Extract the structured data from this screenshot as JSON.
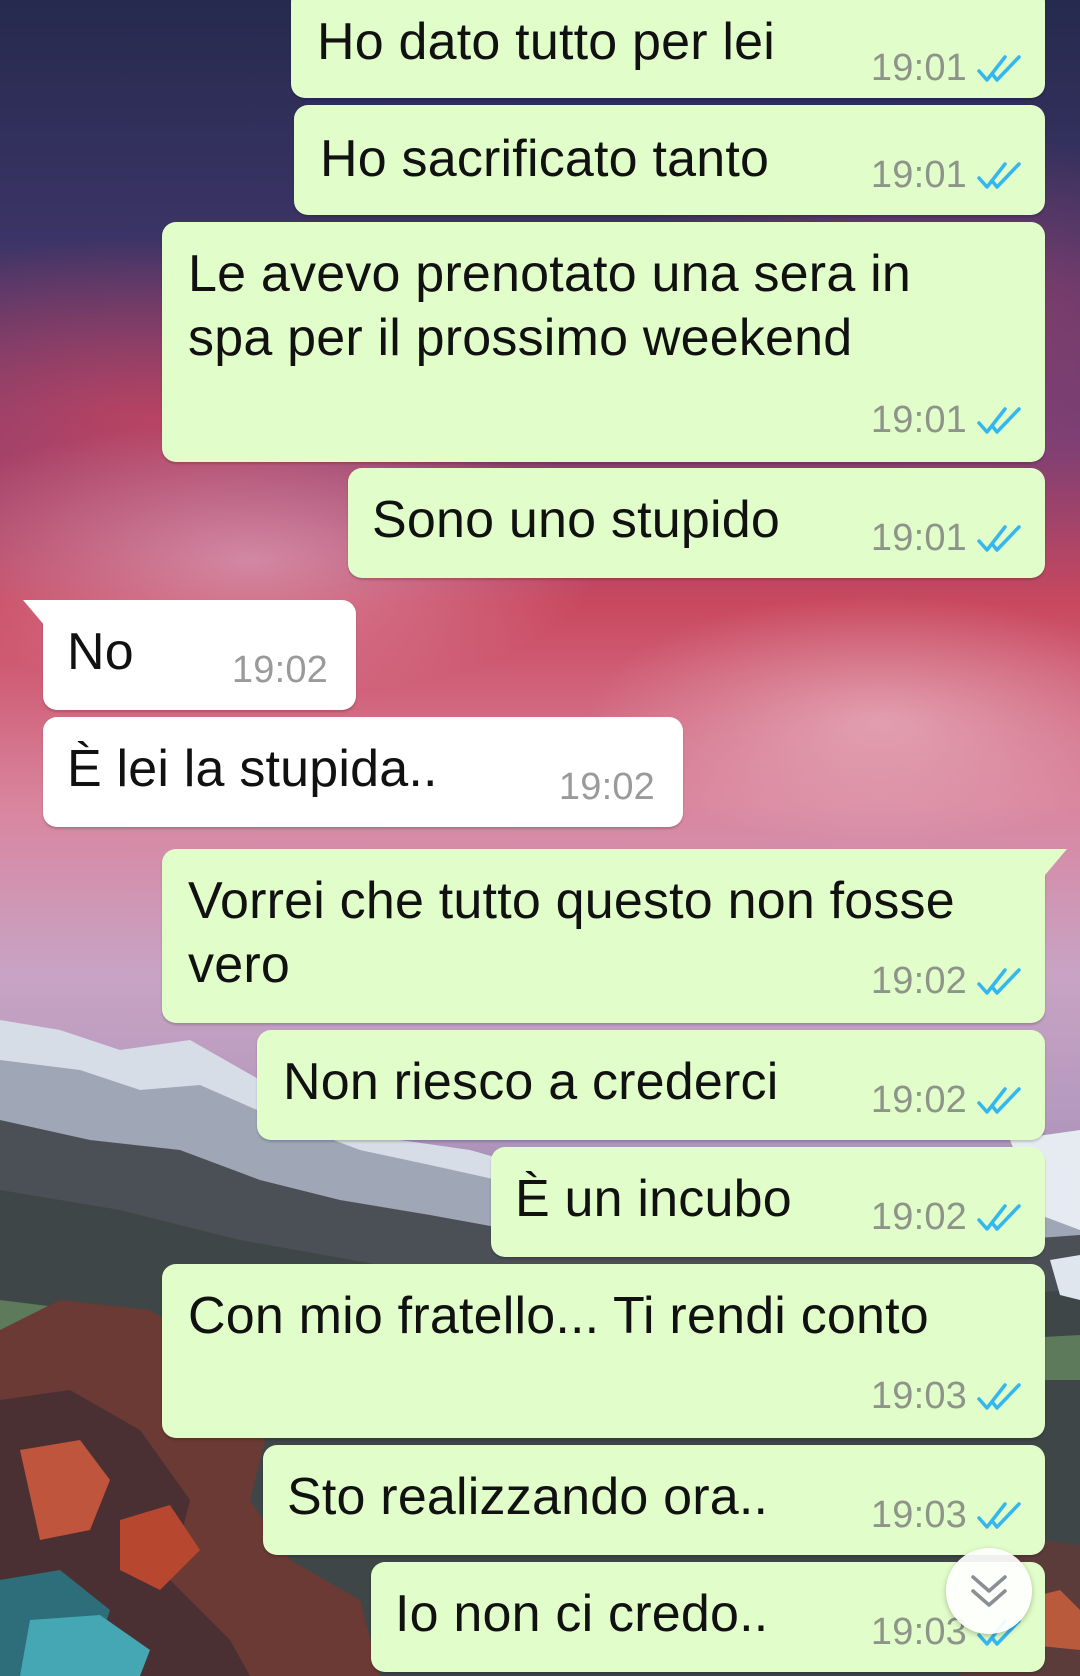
{
  "colors": {
    "outgoing_bubble": "#e1fdc9",
    "incoming_bubble": "#ffffff",
    "read_ticks": "#34b7f1",
    "timestamp": "#8e9489"
  },
  "messages": [
    {
      "id": "m1",
      "direction": "outgoing",
      "text": "Ho dato tutto per lei",
      "time": "19:01",
      "status": "read"
    },
    {
      "id": "m2",
      "direction": "outgoing",
      "text": "Ho sacrificato tanto",
      "time": "19:01",
      "status": "read"
    },
    {
      "id": "m3",
      "direction": "outgoing",
      "text": "Le avevo prenotato una sera in\nspa per il prossimo weekend",
      "time": "19:01",
      "status": "read"
    },
    {
      "id": "m4",
      "direction": "outgoing",
      "text": "Sono uno stupido",
      "time": "19:01",
      "status": "read"
    },
    {
      "id": "m5",
      "direction": "incoming",
      "text": "No",
      "time": "19:02"
    },
    {
      "id": "m6",
      "direction": "incoming",
      "text": "È lei la stupida..",
      "time": "19:02"
    },
    {
      "id": "m7",
      "direction": "outgoing",
      "text": "Vorrei che tutto questo non fosse\nvero",
      "time": "19:02",
      "status": "read"
    },
    {
      "id": "m8",
      "direction": "outgoing",
      "text": "Non riesco a crederci",
      "time": "19:02",
      "status": "read"
    },
    {
      "id": "m9",
      "direction": "outgoing",
      "text": "È un incubo",
      "time": "19:02",
      "status": "read"
    },
    {
      "id": "m10",
      "direction": "outgoing",
      "text": "Con mio fratello... Ti rendi conto",
      "time": "19:03",
      "status": "read"
    },
    {
      "id": "m11",
      "direction": "outgoing",
      "text": "Sto realizzando ora..",
      "time": "19:03",
      "status": "read"
    },
    {
      "id": "m12",
      "direction": "outgoing",
      "text": "Io non ci credo..",
      "time": "19:03",
      "status": "read"
    }
  ],
  "scroll_button": {
    "icon": "double-chevron-down-icon"
  }
}
